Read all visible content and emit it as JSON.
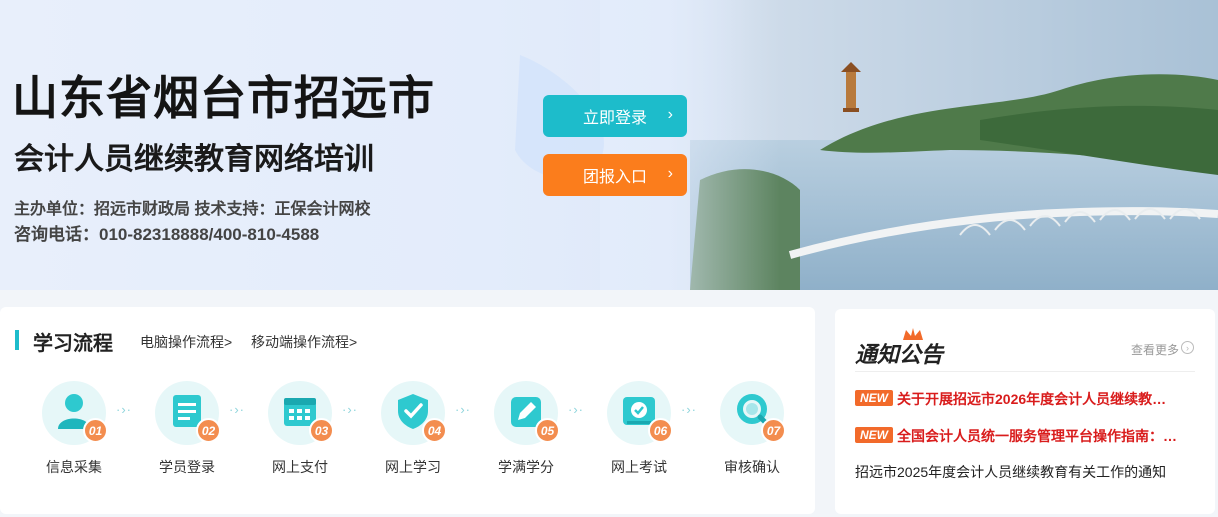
{
  "banner": {
    "title": "山东省烟台市招远市",
    "subtitle": "会计人员继续教育网络培训",
    "organizer": "主办单位：招远市财政局  技术支持：正保会计网校",
    "contact": "咨询电话：010-82318888/400-810-4588",
    "login_button": "立即登录",
    "group_button": "团报入口",
    "arrow": "›"
  },
  "process": {
    "title": "学习流程",
    "pc_link": "电脑操作流程>",
    "mobile_link": "移动端操作流程>",
    "dots": "·›·",
    "steps": [
      {
        "num": "01",
        "label": "信息采集",
        "icon": "user-icon"
      },
      {
        "num": "02",
        "label": "学员登录",
        "icon": "document-icon"
      },
      {
        "num": "03",
        "label": "网上支付",
        "icon": "calendar-icon"
      },
      {
        "num": "04",
        "label": "网上学习",
        "icon": "shield-check-icon"
      },
      {
        "num": "05",
        "label": "学满学分",
        "icon": "edit-icon"
      },
      {
        "num": "06",
        "label": "网上考试",
        "icon": "check-card-icon"
      },
      {
        "num": "07",
        "label": "审核确认",
        "icon": "magnifier-icon"
      }
    ]
  },
  "notice": {
    "title": "通知公告",
    "more": "查看更多",
    "more_icon": "›",
    "items": [
      {
        "badge": "NEW",
        "text": "关于开展招远市2026年度会计人员继续教…"
      },
      {
        "badge": "NEW",
        "text": "全国会计人员统一服务管理平台操作指南：…"
      },
      {
        "badge": "",
        "text": "招远市2025年度会计人员继续教育有关工作的通知"
      }
    ]
  },
  "colors": {
    "teal": "#1dbccb",
    "orange": "#fb7d1c",
    "badge": "#f38d4f",
    "notice_red": "#d91c1c"
  }
}
